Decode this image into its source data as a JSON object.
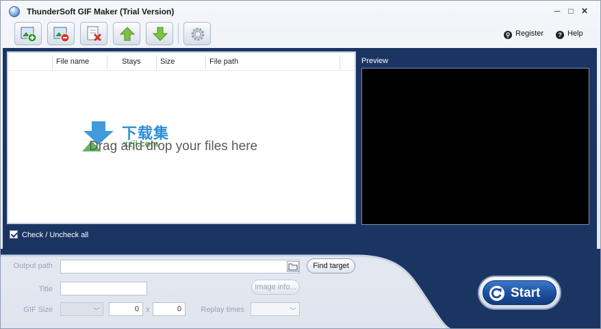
{
  "window": {
    "title": "ThunderSoft GIF Maker (Trial Version)",
    "minimize": "─",
    "maximize": "□",
    "close": "✕"
  },
  "toolbar": {
    "buttons": [
      {
        "name": "add-file",
        "icon": "image-add-icon"
      },
      {
        "name": "remove-file",
        "icon": "image-remove-icon"
      },
      {
        "name": "clear-list",
        "icon": "clear-list-icon"
      },
      {
        "name": "move-up",
        "icon": "arrow-up-icon"
      },
      {
        "name": "move-down",
        "icon": "arrow-down-icon"
      },
      {
        "name": "settings",
        "icon": "gear-icon"
      }
    ],
    "register_label": "Register",
    "help_label": "Help"
  },
  "filelist": {
    "columns": [
      "File name",
      "Stays",
      "Size",
      "File path"
    ],
    "drop_hint": "Drag and drop your files here",
    "watermark_text": "下载集",
    "watermark_sub": "xzji.com"
  },
  "check_all_label": "Check / Uncheck all",
  "preview_label": "Preview",
  "output": {
    "output_path_label": "Output path",
    "output_path_value": "",
    "find_target_label": "Find target",
    "title_label": "Title",
    "title_value": "",
    "image_info_label": "Image info...",
    "gif_size_label": "GIF Size",
    "width_value": "0",
    "height_value": "0",
    "times_sep": "x",
    "replay_label": "Replay times",
    "chevron": "﹀"
  },
  "start_label": "Start",
  "colors": {
    "panel": "#1b3563",
    "accent": "#1c4f9c"
  }
}
